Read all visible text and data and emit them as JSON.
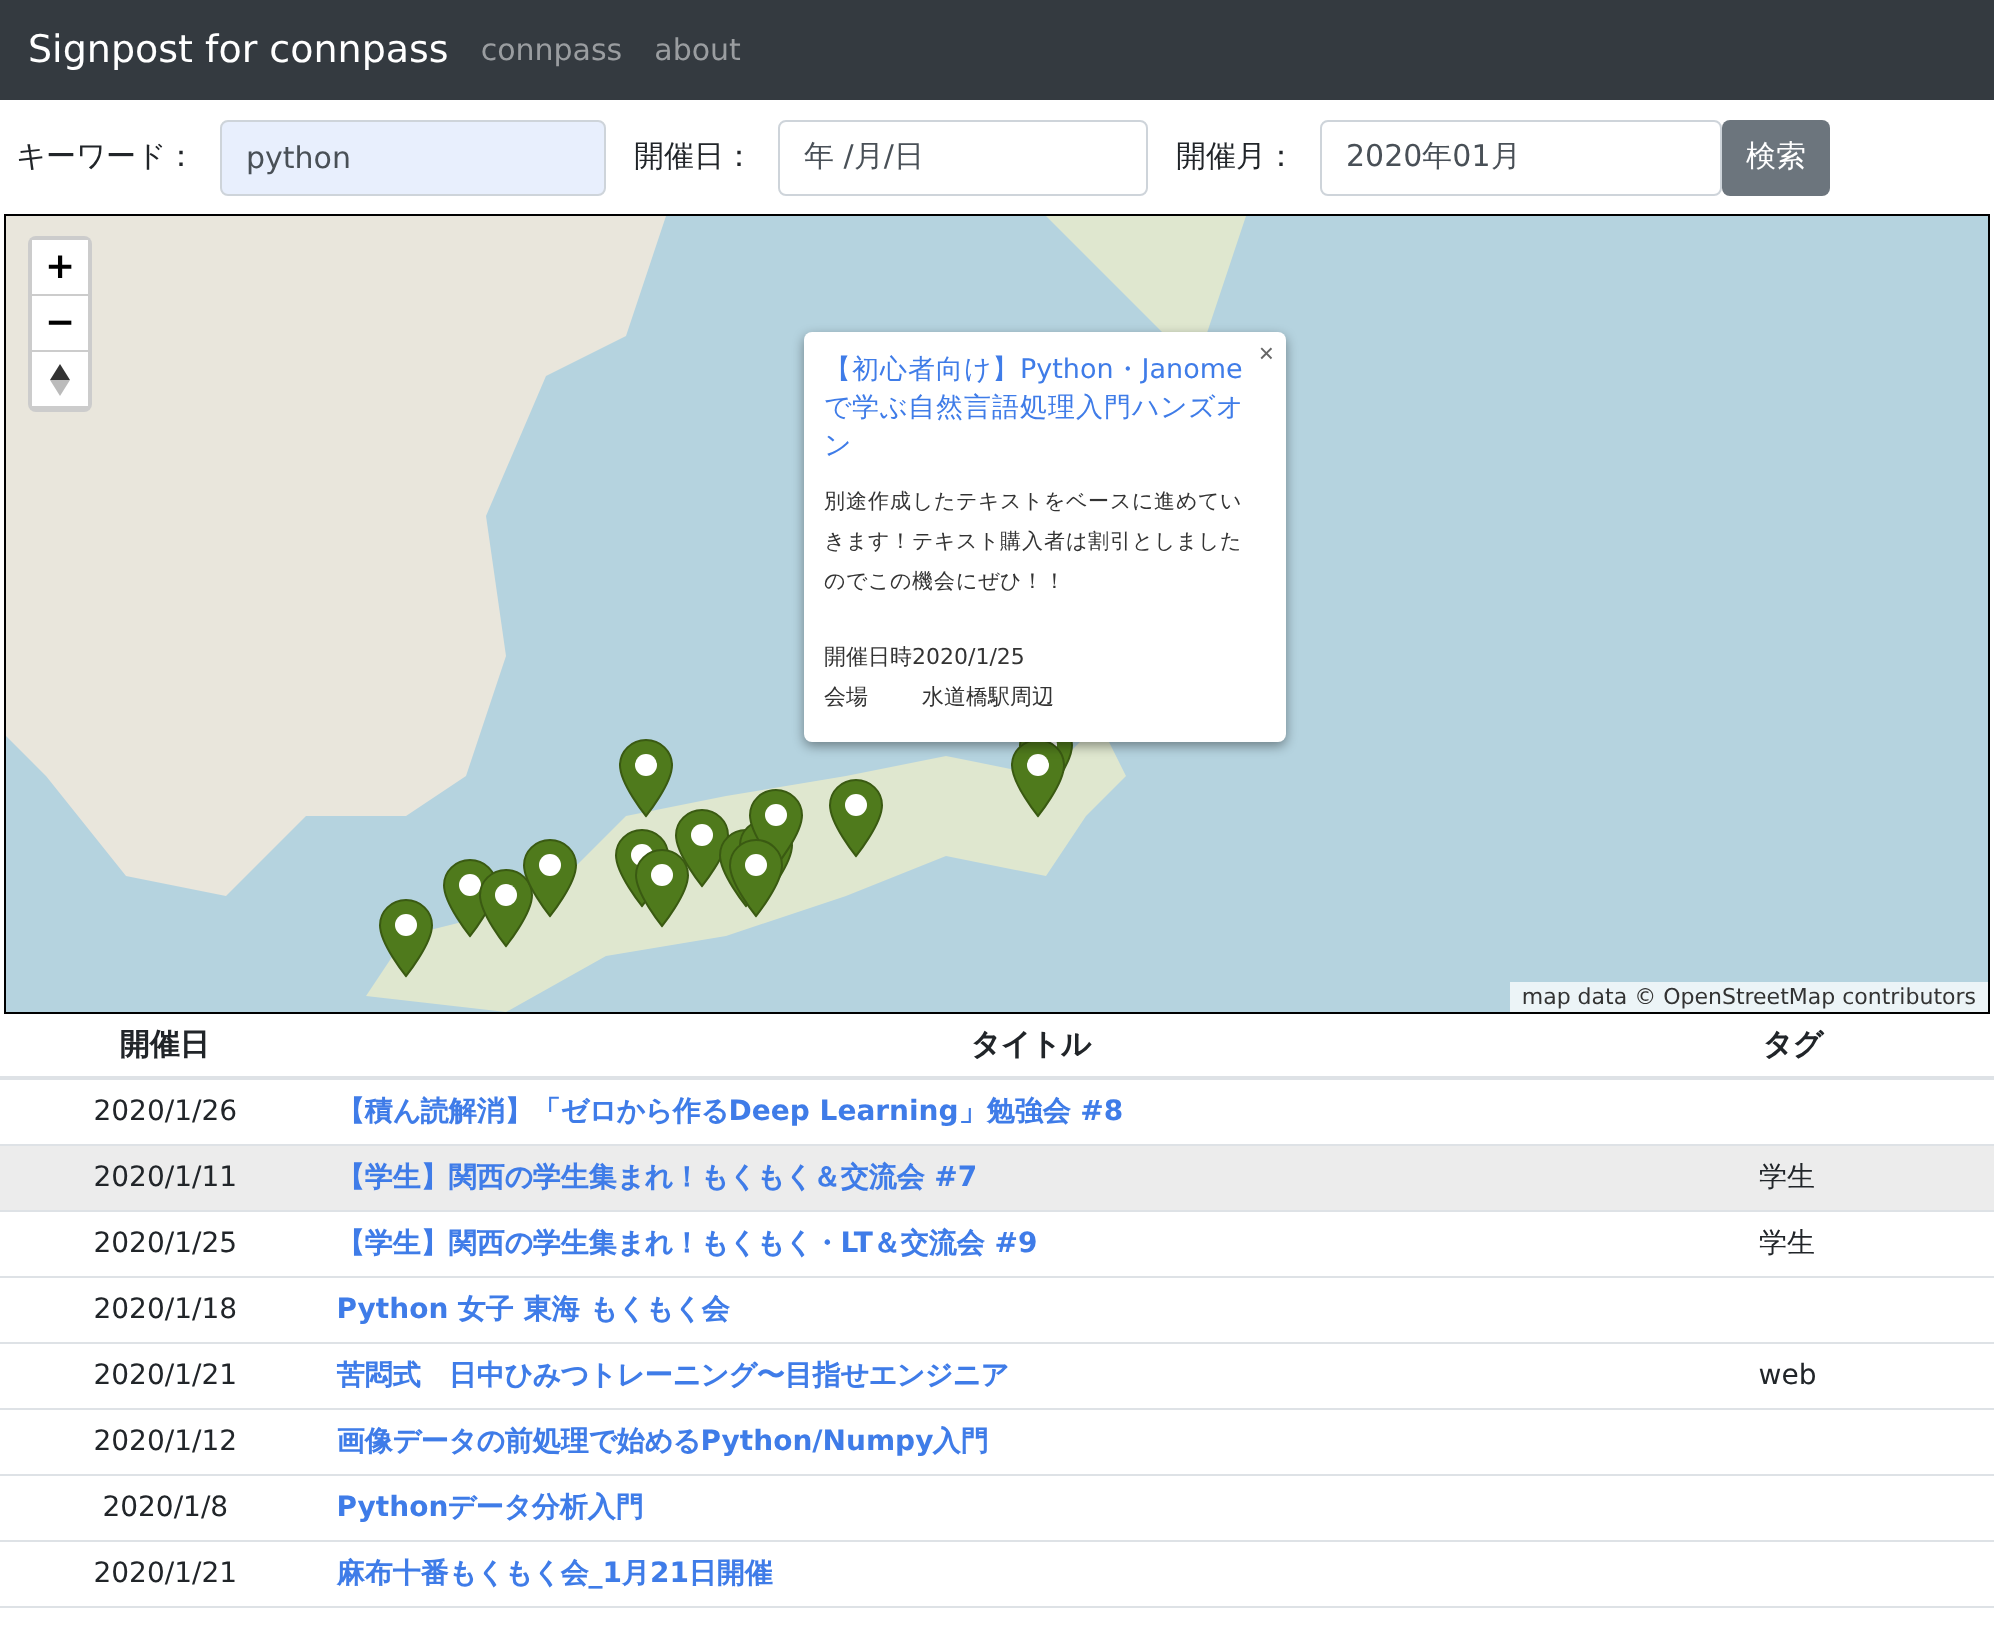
{
  "navbar": {
    "brand": "Signpost for connpass",
    "links": [
      "connpass",
      "about"
    ]
  },
  "search": {
    "keyword_label": "キーワード：",
    "keyword_value": "python",
    "date_label": "開催日：",
    "date_value": "年 /月/日",
    "month_label": "開催月：",
    "month_value": "2020年01月",
    "button": "検索"
  },
  "map": {
    "zoom_in": "+",
    "zoom_out": "−",
    "popup": {
      "close": "×",
      "title": "【初心者向け】Python・Janomeで学ぶ自然言語処理入門ハンズオン",
      "description": "別途作成したテキストをベースに進めていきます！テキスト購入者は割引としましたのでこの機会にぜひ！！",
      "date_label": "開催日時",
      "date": "2020/1/25",
      "venue_label": "会場",
      "venue": "水道橋駅周辺"
    },
    "attribution": "map data © OpenStreetMap contributors"
  },
  "table": {
    "columns": [
      "開催日",
      "タイトル",
      "タグ"
    ],
    "rows": [
      {
        "date": "2020/1/26",
        "title": "【積ん読解消】「ゼロから作るDeep Learning」勉強会 #8",
        "tag": "",
        "selected": false
      },
      {
        "date": "2020/1/11",
        "title": "【学生】関西の学生集まれ！もくもく＆交流会 #7",
        "tag": "学生",
        "selected": true
      },
      {
        "date": "2020/1/25",
        "title": "【学生】関西の学生集まれ！もくもく・LT＆交流会 #9",
        "tag": "学生",
        "selected": false
      },
      {
        "date": "2020/1/18",
        "title": "Python 女子 東海 もくもく会",
        "tag": "",
        "selected": false
      },
      {
        "date": "2020/1/21",
        "title": "苦悶式　日中ひみつトレーニング〜目指せエンジニア",
        "tag": "web",
        "selected": false
      },
      {
        "date": "2020/1/12",
        "title": "画像データの前処理で始めるPython/Numpy入門",
        "tag": "",
        "selected": false
      },
      {
        "date": "2020/1/8",
        "title": "Pythonデータ分析入門",
        "tag": "",
        "selected": false
      },
      {
        "date": "2020/1/21",
        "title": "麻布十番もくもく会_1月21日開催",
        "tag": "",
        "selected": false
      }
    ]
  }
}
